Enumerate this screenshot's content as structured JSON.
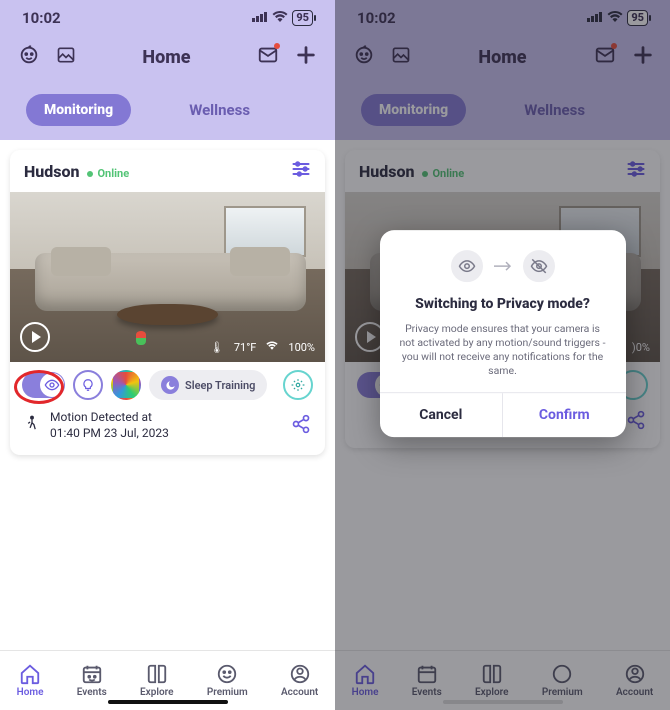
{
  "status": {
    "time": "10:02",
    "battery": "95"
  },
  "header": {
    "title": "Home"
  },
  "tabs": {
    "active_label": "Monitoring",
    "inactive_label": "Wellness"
  },
  "colors": {
    "accent": "#6b5ce0",
    "lavender": "#c9c2f0",
    "pill": "#8378d4",
    "text": "#3d3255",
    "danger": "#e2272b"
  },
  "camera": {
    "name": "Hudson",
    "status": "Online",
    "temperature": "71°F",
    "wifi_pct": "100%",
    "sleep_chip": "Sleep Training",
    "motion_line1": "Motion Detected at",
    "motion_line2": "01:40 PM 23 Jul, 2023"
  },
  "bottom": {
    "items": [
      {
        "label": "Home"
      },
      {
        "label": "Events"
      },
      {
        "label": "Explore"
      },
      {
        "label": "Premium"
      },
      {
        "label": "Account"
      }
    ]
  },
  "modal": {
    "title": "Switching to Privacy mode?",
    "body": "Privacy mode ensures that your camera is not activated by any motion/sound triggers - you will not receive any notifications for the same.",
    "cancel": "Cancel",
    "confirm": "Confirm"
  }
}
